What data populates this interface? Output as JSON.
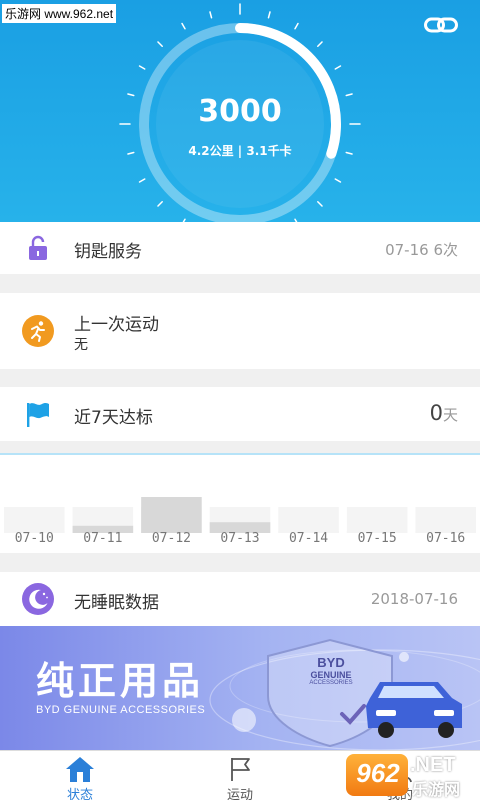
{
  "watermark_top": "乐游网 www.962.net",
  "hero": {
    "steps": "3000",
    "summary": "4.2公里 | 3.1千卡",
    "progress": 0.3
  },
  "rows": {
    "key_service": {
      "title": "钥匙服务",
      "right": "07-16 6次"
    },
    "last_exercise": {
      "title": "上一次运动",
      "sub": "无"
    },
    "target_7d": {
      "title": "近7天达标",
      "count": "0",
      "unit": "天"
    },
    "sleep": {
      "title": "无睡眠数据",
      "right": "2018-07-16"
    }
  },
  "chart_data": {
    "type": "bar",
    "categories": [
      "07-10",
      "07-11",
      "07-12",
      "07-13",
      "07-14",
      "07-15",
      "07-16"
    ],
    "values": [
      0,
      0.2,
      1,
      0.3,
      0,
      0,
      0
    ]
  },
  "banner": {
    "title": "纯正用品",
    "subtitle": "BYD GENUINE ACCESSORIES",
    "badge_line1": "BYD",
    "badge_line2": "GENUINE",
    "badge_line3": "ACCESSORIES"
  },
  "tabs": [
    {
      "label": "状态",
      "icon": "home-icon",
      "active": true
    },
    {
      "label": "运动",
      "icon": "flag-icon",
      "active": false
    },
    {
      "label": "我的",
      "icon": "user-icon",
      "active": false
    }
  ],
  "watermark_bottom": {
    "num": "962",
    "net": ".NET",
    "cn": "乐游网"
  },
  "colors": {
    "accent": "#1a9fe3",
    "purple": "#8a67e0",
    "orange": "#f19a20",
    "flag": "#1ea2e6",
    "tab_active": "#2a7fd8"
  }
}
